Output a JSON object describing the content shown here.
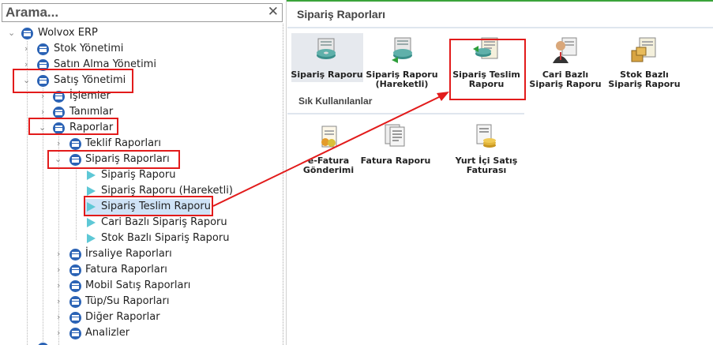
{
  "search": {
    "placeholder": "Arama...",
    "close_glyph": "✕"
  },
  "tree": {
    "root": "Wolvox ERP",
    "stok": "Stok Yönetimi",
    "satin": "Satın Alma Yönetimi",
    "satis": "Satış Yönetimi",
    "islemler": "İşlemler",
    "tanimlar": "Tanımlar",
    "raporlar": "Raporlar",
    "teklif": "Teklif Raporları",
    "siparis_raporlari": "Sipariş Raporları",
    "siparis_raporu": "Sipariş Raporu",
    "siparis_raporu_hareketli": "Sipariş Raporu (Hareketli)",
    "siparis_teslim": "Sipariş Teslim Raporu",
    "cari_bazli": "Cari Bazlı Sipariş Raporu",
    "stok_bazli": "Stok Bazlı Sipariş Raporu",
    "irsaliye": "İrsaliye Raporları",
    "fatura": "Fatura Raporları",
    "mobil": "Mobil Satış Raporları",
    "tup": "Tüp/Su Raporları",
    "diger": "Diğer Raporlar",
    "analizler": "Analizler"
  },
  "panel": {
    "title": "Sipariş Raporları",
    "tiles": {
      "t1": "Sipariş Raporu",
      "t2a": "Sipariş Raporu",
      "t2b": "(Hareketli)",
      "t3a": "Sipariş Teslim",
      "t3b": "Raporu",
      "t4a": "Cari Bazlı",
      "t4b": "Sipariş Raporu",
      "t5a": "Stok Bazlı",
      "t5b": "Sipariş Raporu"
    },
    "frequent_title": "Sık Kullanılanlar",
    "frequent": {
      "f1a": "e-Fatura",
      "f1b": "Gönderimi",
      "f2": "Fatura Raporu",
      "f3a": "Yurt İçi Satış",
      "f3b": "Faturası"
    }
  },
  "colors": {
    "highlight_box": "#e21b1b",
    "tree_icon": "#2b63b5",
    "leaf_icon": "#5ec8d6",
    "selected": "#cfe3f7"
  }
}
